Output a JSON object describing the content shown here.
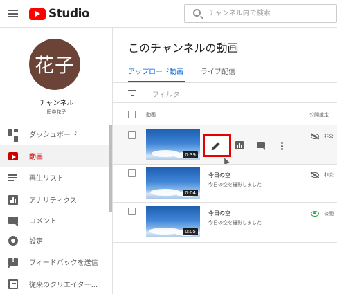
{
  "header": {
    "app_name": "Studio",
    "search_placeholder": "チャンネル内で検索"
  },
  "sidebar": {
    "avatar_text": "花子",
    "channel_label": "チャンネル",
    "channel_owner": "田中花子",
    "items": [
      {
        "label": "ダッシュボード",
        "icon": "dashboard-icon"
      },
      {
        "label": "動画",
        "icon": "video-icon",
        "active": true
      },
      {
        "label": "再生リスト",
        "icon": "playlist-icon"
      },
      {
        "label": "アナリティクス",
        "icon": "analytics-icon"
      },
      {
        "label": "コメント",
        "icon": "comment-icon"
      },
      {
        "label": "設定",
        "icon": "gear-icon"
      },
      {
        "label": "フィードバックを送信",
        "icon": "feedback-icon"
      },
      {
        "label": "従来のクリエイター...",
        "icon": "classic-studio-icon"
      }
    ]
  },
  "main": {
    "title": "このチャンネルの動画",
    "tabs": [
      {
        "label": "アップロード動画",
        "active": true
      },
      {
        "label": "ライブ配信"
      }
    ],
    "filter_label": "フィルタ",
    "columns": {
      "video": "動画",
      "visibility": "公開設定"
    },
    "videos": [
      {
        "title": "",
        "description": "",
        "duration": "0:39",
        "visibility": "非公",
        "visibility_icon": "visibility-off-icon"
      },
      {
        "title": "今日の空",
        "description": "今日の空を撮影しました",
        "duration": "0:04",
        "visibility": "非公",
        "visibility_icon": "visibility-off-icon"
      },
      {
        "title": "今日の空",
        "description": "今日の空を撮影しました",
        "duration": "0:05",
        "visibility": "公開",
        "visibility_icon": "visibility-public-icon"
      }
    ]
  },
  "colors": {
    "brand_red": "#ff0000",
    "active_red": "#cc0000",
    "highlight_red": "#e60000",
    "link_blue": "#065fd4",
    "public_green": "#2ba640",
    "avatar_brown": "#6b4437"
  }
}
